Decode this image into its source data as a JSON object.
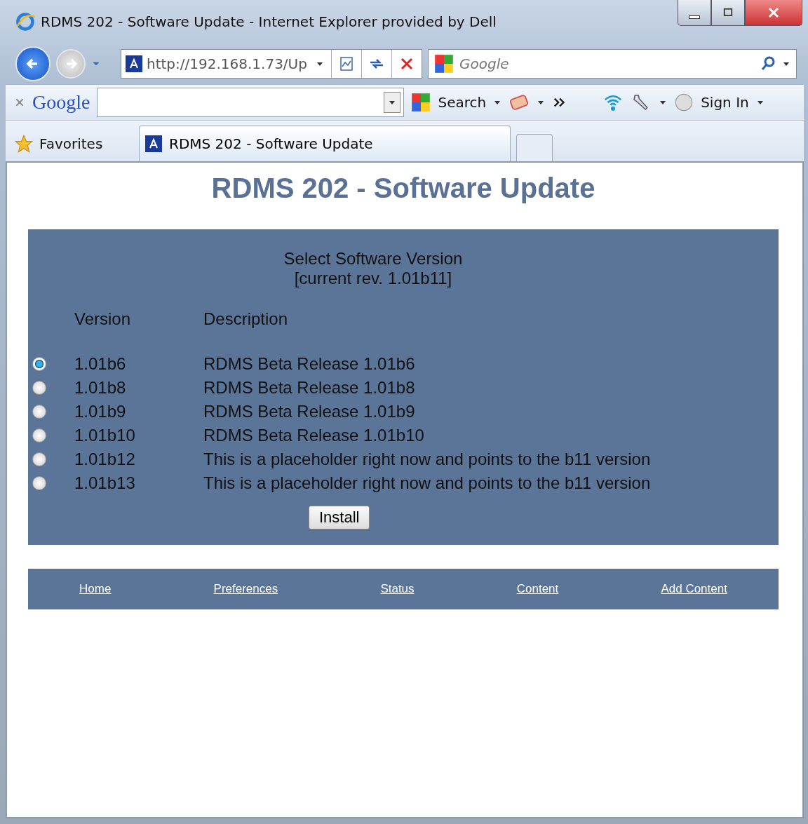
{
  "window": {
    "title": "RDMS 202 - Software Update - Internet Explorer provided by Dell"
  },
  "nav_bar": {
    "address": "http://192.168.1.73/Up",
    "search_placeholder": "Google"
  },
  "google_toolbar": {
    "logo": "Google",
    "search_label": "Search",
    "sign_in": "Sign In"
  },
  "favorites_bar": {
    "favorites": "Favorites",
    "tabs": [
      {
        "label": "RDMS 202 - Software Update",
        "selected": true
      }
    ]
  },
  "page": {
    "heading": "RDMS 202 - Software Update",
    "panel_title": "Select Software Version",
    "current_rev": "[current rev. 1.01b11]",
    "columns": [
      "Version",
      "Description"
    ],
    "rows": [
      {
        "version": "1.01b6",
        "description": "RDMS Beta Release 1.01b6",
        "selected": true
      },
      {
        "version": "1.01b8",
        "description": "RDMS Beta Release 1.01b8",
        "selected": false
      },
      {
        "version": "1.01b9",
        "description": "RDMS Beta Release 1.01b9",
        "selected": false
      },
      {
        "version": "1.01b10",
        "description": "RDMS Beta Release 1.01b10",
        "selected": false
      },
      {
        "version": "1.01b12",
        "description": "This is a placeholder right now and points to the b11 version",
        "selected": false
      },
      {
        "version": "1.01b13",
        "description": "This is a placeholder right now and points to the b11 version",
        "selected": false
      }
    ],
    "install_button": "Install",
    "footer_links": [
      "Home",
      "Preferences",
      "Status",
      "Content",
      "Add Content"
    ]
  }
}
